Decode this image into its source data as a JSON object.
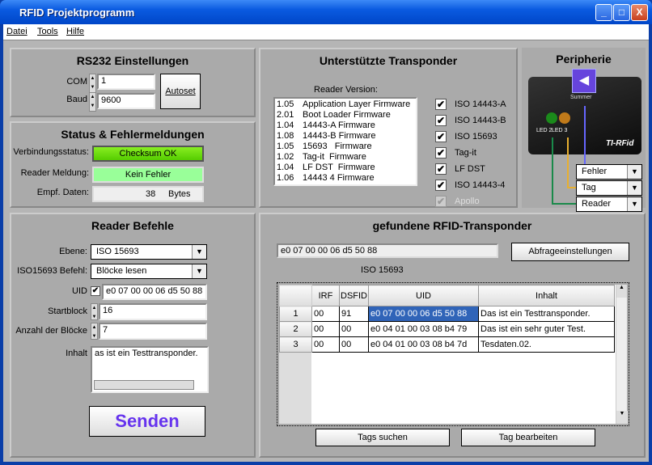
{
  "window": {
    "title": "RFID Projektprogramm",
    "minimize": "_",
    "maximize": "□",
    "close": "X"
  },
  "menu": [
    "Datei",
    "Tools",
    "Hilfe"
  ],
  "rs232": {
    "title": "RS232 Einstellungen",
    "com_label": "COM",
    "com_value": "1",
    "baud_label": "Baud",
    "baud_value": "9600",
    "autoset": "Autoset"
  },
  "status": {
    "title": "Status & Fehlermeldungen",
    "conn_label": "Verbindungsstatus:",
    "conn_value": "Checksum OK",
    "reader_label": "Reader Meldung:",
    "reader_value": "Kein Fehler",
    "data_label": "Empf. Daten:",
    "data_value": "38",
    "data_unit": "Bytes",
    "colors": {
      "ok": "#66dd00",
      "noerror": "#99ff99"
    }
  },
  "commands": {
    "title": "Reader Befehle",
    "ebene_label": "Ebene:",
    "ebene_value": "ISO 15693",
    "befehl_label": "ISO15693 Befehl:",
    "befehl_value": "Blöcke lesen",
    "uid_label": "UID",
    "uid_checked": true,
    "uid_value": "e0 07 00 00 06 d5 50 88",
    "start_label": "Startblock",
    "start_value": "16",
    "count_label": "Anzahl der Blöcke",
    "count_value": "7",
    "content_label": "Inhalt",
    "content_value": "as ist ein Testtransponder.",
    "send": "Senden"
  },
  "transponder": {
    "title": "Unterstützte Transponder",
    "version_label": "Reader Version:",
    "versions": [
      [
        "1.05",
        "Application Layer Firmware"
      ],
      [
        "2.01",
        "Boot Loader Firmware"
      ],
      [
        "1.04",
        "14443-A Firmware"
      ],
      [
        "1.08",
        "14443-B Firmware"
      ],
      [
        "1.05",
        "15693   Firmware"
      ],
      [
        "1.02",
        "Tag-it  Firmware"
      ],
      [
        "1.04",
        "LF DST  Firmware"
      ],
      [
        "1.06",
        "14443 4 Firmware"
      ]
    ],
    "types": [
      {
        "label": "ISO 14443-A",
        "checked": true
      },
      {
        "label": "ISO 14443-B",
        "checked": true
      },
      {
        "label": "ISO 15693",
        "checked": true
      },
      {
        "label": "Tag-it",
        "checked": true
      },
      {
        "label": "LF DST",
        "checked": true
      },
      {
        "label": "ISO 14443-4",
        "checked": true
      },
      {
        "label": "Apollo",
        "checked": true,
        "disabled": true
      }
    ]
  },
  "periphery": {
    "title": "Peripherie",
    "buzzer": "Summer",
    "led2": "LED 2",
    "led3": "LED 3",
    "logo": "TI-RFid",
    "selects": [
      "Fehler",
      "Tag",
      "Reader"
    ]
  },
  "found": {
    "title": "gefundene RFID-Transponder",
    "selected_uid": "e0 07 00 00 06 d5 50 88",
    "settings_btn": "Abfrageeinstellungen",
    "standard": "ISO 15693",
    "columns": [
      "IRF",
      "DSFID",
      "UID",
      "Inhalt"
    ],
    "rows": [
      {
        "n": "1",
        "irf": "00",
        "dsfid": "91",
        "uid": "e0 07 00 00 06 d5 50 88",
        "content": "Das ist ein Testtransponder."
      },
      {
        "n": "2",
        "irf": "00",
        "dsfid": "00",
        "uid": "e0 04 01 00 03 08 b4 79",
        "content": "Das ist ein sehr guter Test."
      },
      {
        "n": "3",
        "irf": "00",
        "dsfid": "00",
        "uid": "e0 04 01 00 03 08 b4 7d",
        "content": "Tesdaten.02."
      }
    ],
    "search_btn": "Tags suchen",
    "edit_btn": "Tag bearbeiten"
  }
}
